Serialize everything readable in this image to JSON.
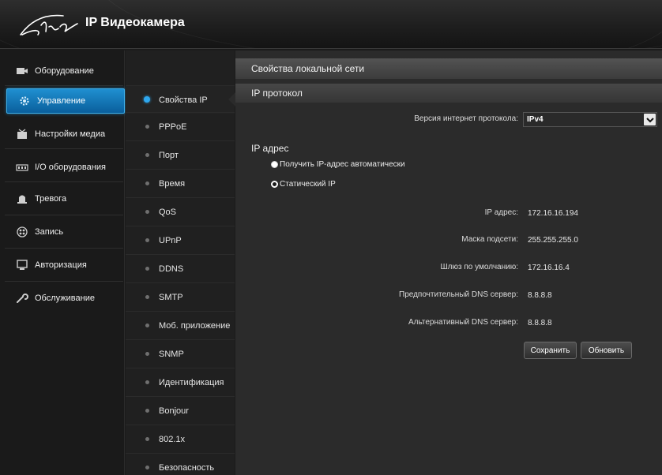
{
  "app": {
    "title": "IP Видеокамера",
    "logo_icon": "stic-logo-icon"
  },
  "main_nav": [
    {
      "label": "Оборудование",
      "icon": "camera-icon"
    },
    {
      "label": "Управление",
      "icon": "gear-icon",
      "active": true
    },
    {
      "label": "Настройки медиа",
      "icon": "media-icon"
    },
    {
      "label": "I/O оборудования",
      "icon": "io-icon"
    },
    {
      "label": "Тревога",
      "icon": "alarm-icon"
    },
    {
      "label": "Запись",
      "icon": "record-icon"
    },
    {
      "label": "Авторизация",
      "icon": "monitor-icon"
    },
    {
      "label": "Обслуживание",
      "icon": "wrench-icon"
    }
  ],
  "sub_nav": [
    {
      "label": "Свойства IP",
      "active": true
    },
    {
      "label": "PPPoE"
    },
    {
      "label": "Порт"
    },
    {
      "label": "Время"
    },
    {
      "label": "QoS"
    },
    {
      "label": "UPnP"
    },
    {
      "label": "DDNS"
    },
    {
      "label": "SMTP"
    },
    {
      "label": "Моб. приложение"
    },
    {
      "label": "SNMP"
    },
    {
      "label": "Идентификация"
    },
    {
      "label": "Bonjour"
    },
    {
      "label": "802.1x"
    },
    {
      "label": "Безопасность"
    }
  ],
  "content": {
    "panel_title": "Свойства локальной сети",
    "protocol_section": "IP протокол",
    "protocol_label": "Версия интернет протокола:",
    "protocol_value": "IPv4",
    "address_section": "IP адрес",
    "radio_auto": "Получить IP-адрес автоматически",
    "radio_static": "Статический IP",
    "radio_selected": "static",
    "fields": [
      {
        "label": "IP адрес:",
        "value": "172.16.16.194"
      },
      {
        "label": "Маска подсети:",
        "value": "255.255.255.0"
      },
      {
        "label": "Шлюз по умолчанию:",
        "value": "172.16.16.4"
      },
      {
        "label": "Предпочтительный DNS сервер:",
        "value": "8.8.8.8"
      },
      {
        "label": "Альтернативный DNS сервер:",
        "value": "8.8.8.8"
      }
    ],
    "save_label": "Сохранить",
    "refresh_label": "Обновить"
  },
  "colors": {
    "accent": "#1f8fd0",
    "active_dot": "#2ea7ee"
  }
}
